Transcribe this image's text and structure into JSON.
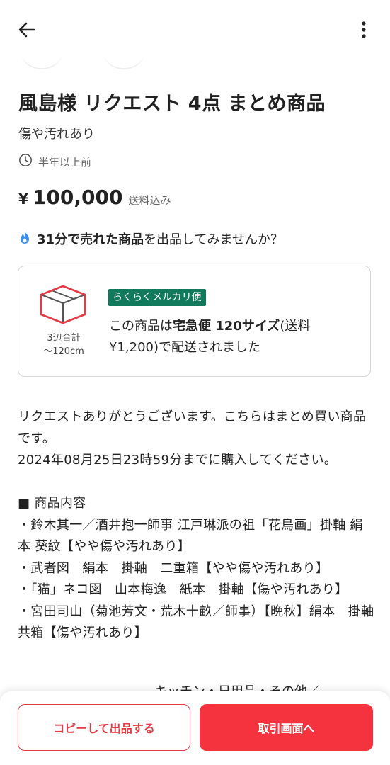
{
  "header": {
    "back_icon": "arrow-left-icon",
    "more_icon": "more-vertical-icon"
  },
  "item": {
    "title": "風島様 リクエスト 4点 まとめ商品",
    "condition": "傷や汚れあり",
    "posted_time": "半年以上前",
    "price_symbol": "¥",
    "price": "100,000",
    "shipping_note": "送料込み"
  },
  "promo": {
    "icon": "flame-icon",
    "strong": "31分で売れた商品",
    "rest": "を出品してみませんか？"
  },
  "shipping": {
    "box_icon": "box-icon",
    "size_line1": "3辺合計",
    "size_line2": "～120cm",
    "badge": "らくらくメルカリ便",
    "desc_pre": "この商品は",
    "desc_strong": "宅急便 120サイズ",
    "desc_post": "(送料¥1,200)で配送されました"
  },
  "description": "リクエストありがとうございます。こちらはまとめ買い商品です。\n2024年08月25日23時59分までに購入してください。\n\n■ 商品内容\n・鈴木其一／酒井抱一師事 江戸琳派の祖「花鳥画」掛軸 絹本 葵紋【やや傷や汚れあり】\n・武者図　絹本　掛軸　二重箱【やや傷や汚れあり】\n・「猫」ネコ図　山本梅逸　紙本　掛軸【傷や汚れあり】\n・宮田司山（菊池芳文・荒木十畝／師事）【晩秋】絹本　掛軸　共箱【傷や汚れあり】",
  "description_cut": "キッチン・日用品・その他／",
  "actions": {
    "copy_label": "コピーして出品する",
    "trade_label": "取引画面へ"
  },
  "colors": {
    "accent": "#f5333f",
    "badge_green": "#127a5c",
    "flame_blue": "#3a8ef0"
  }
}
